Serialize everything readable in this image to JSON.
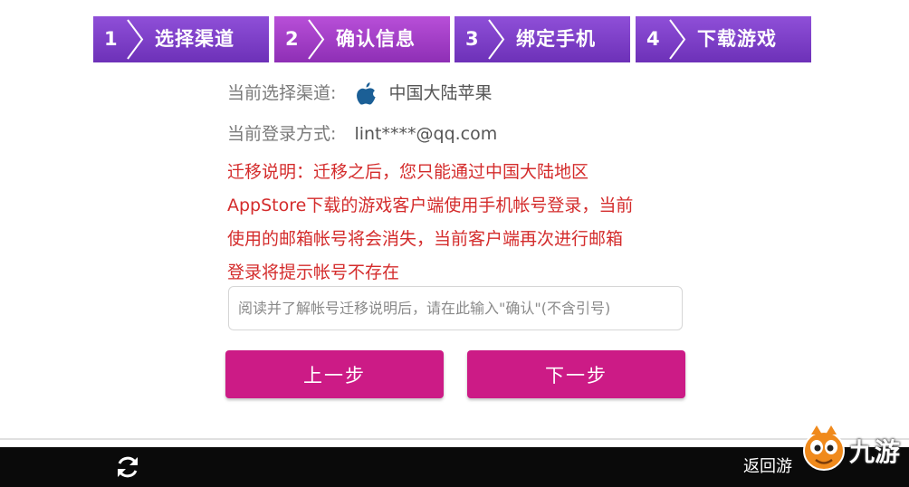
{
  "steps": [
    {
      "num": "1",
      "label": "选择渠道"
    },
    {
      "num": "2",
      "label": "确认信息"
    },
    {
      "num": "3",
      "label": "绑定手机"
    },
    {
      "num": "4",
      "label": "下载游戏"
    }
  ],
  "active_step": 2,
  "channel": {
    "label": "当前选择渠道:",
    "value": "中国大陆苹果",
    "icon": "apple-icon"
  },
  "login": {
    "label": "当前登录方式:",
    "value": "lint****@qq.com"
  },
  "notice": {
    "lines": [
      "迁移说明：迁移之后，您只能通过中国大陆地区",
      "AppStore下载的游戏客户端使用手机帐号登录，当前",
      "使用的邮箱帐号将会消失，当前客户端再次进行邮箱",
      "登录将提示帐号不存在"
    ],
    "color": "#d42c2c"
  },
  "confirm_input": {
    "placeholder": "阅读并了解帐号迁移说明后，请在此输入\"确认\"(不含引号)",
    "value": ""
  },
  "buttons": {
    "prev": "上一步",
    "next": "下一步",
    "color": "#cc1b86"
  },
  "bottom_bar": {
    "refresh_icon": "refresh-icon",
    "back_label": "返回游"
  },
  "watermark": {
    "text": "九游"
  }
}
